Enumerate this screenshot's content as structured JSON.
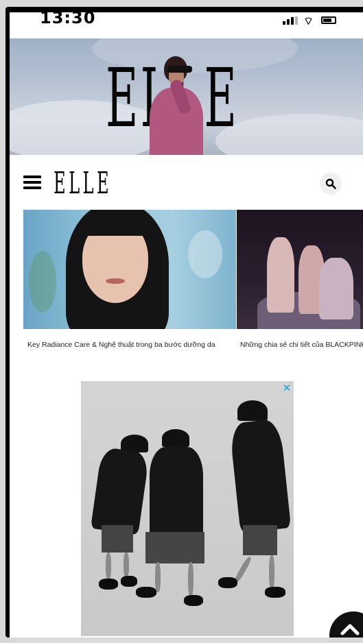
{
  "status_bar": {
    "time": "13:30"
  },
  "hero": {
    "logo_text": "ELLE"
  },
  "header": {
    "brand": "ELLE"
  },
  "articles": [
    {
      "title": "Key Radiance Care & Nghệ thuật trong ba bước dưỡng da"
    },
    {
      "title": "Những chia sẻ chi tiết của BLACKPINK về \"Pink Venom\" và album \"Born Pink\""
    }
  ],
  "ad": {
    "close_glyph": "✕"
  },
  "icons": [
    "signal-icon",
    "wifi-icon",
    "battery-icon",
    "menu-icon",
    "search-icon",
    "close-icon",
    "chevron-up-icon"
  ]
}
